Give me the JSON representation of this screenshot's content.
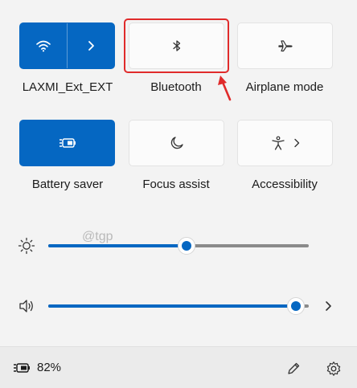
{
  "tiles": {
    "wifi": {
      "label": "LAXMI_Ext_EXT",
      "icon": "wifi-icon",
      "state": "on"
    },
    "bluetooth": {
      "label": "Bluetooth",
      "icon": "bluetooth-icon",
      "state": "off"
    },
    "airplane": {
      "label": "Airplane mode",
      "icon": "airplane-icon",
      "state": "off"
    },
    "battery_saver": {
      "label": "Battery saver",
      "icon": "battery-saver-icon",
      "state": "on"
    },
    "focus_assist": {
      "label": "Focus assist",
      "icon": "moon-icon",
      "state": "off"
    },
    "accessibility": {
      "label": "Accessibility",
      "icon": "accessibility-icon",
      "state": "off"
    }
  },
  "sliders": {
    "brightness": {
      "icon": "brightness-icon",
      "level": 0.53
    },
    "volume": {
      "icon": "speaker-icon",
      "level": 0.95
    }
  },
  "watermark": "@tgp",
  "footer": {
    "battery_percent": "82%",
    "battery_icon": "battery-charging-icon",
    "edit_icon": "pencil-icon",
    "settings_icon": "gear-icon"
  },
  "colors": {
    "accent": "#0567c2",
    "highlight": "#e02b2b",
    "background": "#f3f3f3"
  }
}
